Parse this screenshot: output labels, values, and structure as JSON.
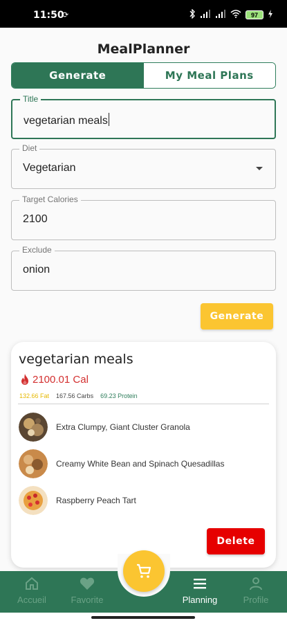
{
  "status_bar": {
    "time": "11:50",
    "battery": "97"
  },
  "app": {
    "title": "MealPlanner"
  },
  "tabs": {
    "generate": "Generate",
    "my_plans": "My Meal Plans"
  },
  "form": {
    "title": {
      "label": "Title",
      "value": "vegetarian meals"
    },
    "diet": {
      "label": "Diet",
      "value": "Vegetarian"
    },
    "calories": {
      "label": "Target Calories",
      "value": "2100"
    },
    "exclude": {
      "label": "Exclude",
      "value": "onion"
    },
    "generate_button": "Generate"
  },
  "plan_card": {
    "title": "vegetarian meals",
    "calories": "2100.01 Cal",
    "fat": "132.66 Fat",
    "carbs": "167.56 Carbs",
    "protein": "69.23 Protein",
    "meals": [
      {
        "name": "Extra Clumpy, Giant Cluster Granola",
        "image": "granola-photo"
      },
      {
        "name": "Creamy White Bean and Spinach Quesadillas",
        "image": "quesadilla-photo"
      },
      {
        "name": "Raspberry Peach Tart",
        "image": "tart-photo"
      }
    ],
    "delete_button": "Delete"
  },
  "nav": {
    "items": [
      {
        "label": "Accueil",
        "icon": "home-icon",
        "active": false
      },
      {
        "label": "Favorite",
        "icon": "heart-icon",
        "active": false
      },
      {
        "label": "Planning",
        "icon": "menu-icon",
        "active": true
      },
      {
        "label": "Profile",
        "icon": "person-icon",
        "active": false
      }
    ],
    "fab_icon": "cart-icon"
  },
  "colors": {
    "primary": "#2e7656",
    "accent": "#fbc531",
    "danger": "#e60000",
    "calorie": "#d32f2f"
  }
}
